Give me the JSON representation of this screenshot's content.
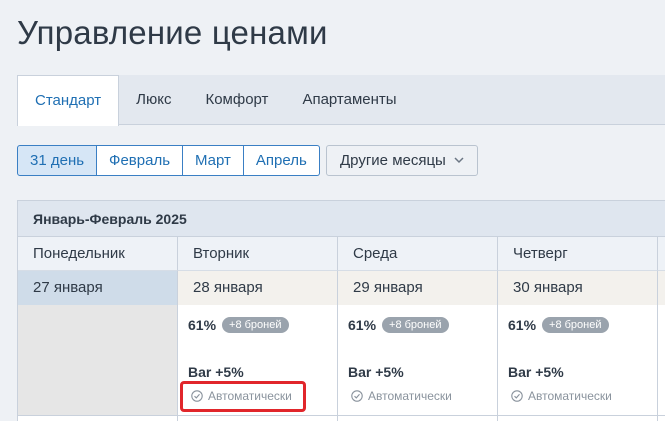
{
  "page_title": "Управление ценами",
  "tabs": [
    {
      "label": "Стандарт",
      "active": true
    },
    {
      "label": "Люкс",
      "active": false
    },
    {
      "label": "Комфорт",
      "active": false
    },
    {
      "label": "Апартаменты",
      "active": false
    }
  ],
  "periods": [
    {
      "label": "31 день",
      "selected": true
    },
    {
      "label": "Февраль",
      "selected": false
    },
    {
      "label": "Март",
      "selected": false
    },
    {
      "label": "Апрель",
      "selected": false
    }
  ],
  "other_months_label": "Другие месяцы",
  "calendar": {
    "heading": "Январь-Февраль 2025",
    "weekdays": [
      "Понедельник",
      "Вторник",
      "Среда",
      "Четверг"
    ],
    "dates": [
      "27 января",
      "28 января",
      "29 января",
      "30 января"
    ],
    "days": [
      {
        "occupancy": "61%",
        "badge": "+8 броней",
        "bar": "Bar +5%",
        "mode": "Автоматически"
      },
      {
        "occupancy": "61%",
        "badge": "+8 броней",
        "bar": "Bar +5%",
        "mode": "Автоматически"
      },
      {
        "occupancy": "61%",
        "badge": "+8 броней",
        "bar": "Bar +5%",
        "mode": "Автоматически"
      }
    ]
  },
  "colors": {
    "accent": "#1f6fb3",
    "highlight": "#e1262b",
    "badge": "#9aa3ad"
  }
}
